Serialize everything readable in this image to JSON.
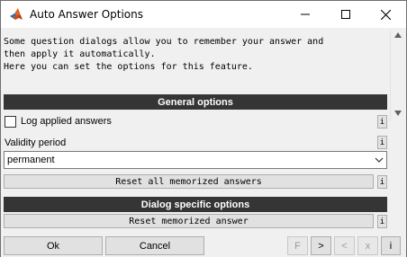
{
  "window": {
    "title": "Auto Answer Options",
    "icon": "matlab-logo-icon"
  },
  "intro": {
    "lines": [
      "Some question dialogs allow you to remember your answer and",
      "then apply it automatically.",
      "Here you can set the options for this feature."
    ]
  },
  "general": {
    "header": "General options",
    "log_checkbox_label": "Log applied answers",
    "log_checked": false,
    "validity_label": "Validity period",
    "validity_value": "permanent",
    "reset_all_label": "Reset all memorized answers",
    "info_label": "i"
  },
  "dialog_specific": {
    "header": "Dialog specific options",
    "reset_label": "Reset memorized answer",
    "info_label": "i"
  },
  "footer": {
    "ok_label": "Ok",
    "cancel_label": "Cancel",
    "nav": [
      "F",
      ">",
      "<",
      "x",
      "i"
    ]
  },
  "colors": {
    "header_bg": "#353535",
    "header_fg": "#ffffff",
    "window_bg": "#f0f0f0"
  }
}
